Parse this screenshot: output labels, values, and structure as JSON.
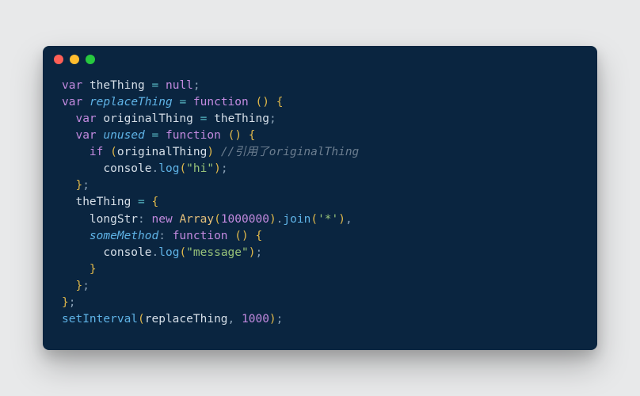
{
  "titlebar": {
    "buttons": [
      "close",
      "minimize",
      "zoom"
    ]
  },
  "code": {
    "tokens": [
      [
        {
          "t": "kw",
          "v": "var"
        },
        {
          "t": "punct",
          "v": " "
        },
        {
          "t": "ident",
          "v": "theThing"
        },
        {
          "t": "punct",
          "v": " "
        },
        {
          "t": "op",
          "v": "="
        },
        {
          "t": "punct",
          "v": " "
        },
        {
          "t": "null",
          "v": "null"
        },
        {
          "t": "punct",
          "v": ";"
        }
      ],
      [
        {
          "t": "kw",
          "v": "var"
        },
        {
          "t": "punct",
          "v": " "
        },
        {
          "t": "fn",
          "v": "replaceThing"
        },
        {
          "t": "punct",
          "v": " "
        },
        {
          "t": "op",
          "v": "="
        },
        {
          "t": "punct",
          "v": " "
        },
        {
          "t": "kw2",
          "v": "function"
        },
        {
          "t": "punct",
          "v": " "
        },
        {
          "t": "paren",
          "v": "("
        },
        {
          "t": "paren",
          "v": ")"
        },
        {
          "t": "punct",
          "v": " "
        },
        {
          "t": "paren",
          "v": "{"
        }
      ],
      [
        {
          "t": "punct",
          "v": "  "
        },
        {
          "t": "kw",
          "v": "var"
        },
        {
          "t": "punct",
          "v": " "
        },
        {
          "t": "ident",
          "v": "originalThing"
        },
        {
          "t": "punct",
          "v": " "
        },
        {
          "t": "op",
          "v": "="
        },
        {
          "t": "punct",
          "v": " "
        },
        {
          "t": "ident",
          "v": "theThing"
        },
        {
          "t": "punct",
          "v": ";"
        }
      ],
      [
        {
          "t": "punct",
          "v": "  "
        },
        {
          "t": "kw",
          "v": "var"
        },
        {
          "t": "punct",
          "v": " "
        },
        {
          "t": "fn",
          "v": "unused"
        },
        {
          "t": "punct",
          "v": " "
        },
        {
          "t": "op",
          "v": "="
        },
        {
          "t": "punct",
          "v": " "
        },
        {
          "t": "kw2",
          "v": "function"
        },
        {
          "t": "punct",
          "v": " "
        },
        {
          "t": "paren",
          "v": "("
        },
        {
          "t": "paren",
          "v": ")"
        },
        {
          "t": "punct",
          "v": " "
        },
        {
          "t": "paren",
          "v": "{"
        }
      ],
      [
        {
          "t": "punct",
          "v": "    "
        },
        {
          "t": "kw2",
          "v": "if"
        },
        {
          "t": "punct",
          "v": " "
        },
        {
          "t": "paren",
          "v": "("
        },
        {
          "t": "ident",
          "v": "originalThing"
        },
        {
          "t": "paren",
          "v": ")"
        },
        {
          "t": "punct",
          "v": " "
        },
        {
          "t": "cmt",
          "v": "//引用了originalThing"
        }
      ],
      [
        {
          "t": "punct",
          "v": "      "
        },
        {
          "t": "console",
          "v": "console"
        },
        {
          "t": "punct",
          "v": "."
        },
        {
          "t": "log",
          "v": "log"
        },
        {
          "t": "paren",
          "v": "("
        },
        {
          "t": "str",
          "v": "\"hi\""
        },
        {
          "t": "paren",
          "v": ")"
        },
        {
          "t": "punct",
          "v": ";"
        }
      ],
      [
        {
          "t": "punct",
          "v": "  "
        },
        {
          "t": "paren",
          "v": "}"
        },
        {
          "t": "punct",
          "v": ";"
        }
      ],
      [
        {
          "t": "punct",
          "v": "  "
        },
        {
          "t": "ident",
          "v": "theThing"
        },
        {
          "t": "punct",
          "v": " "
        },
        {
          "t": "op",
          "v": "="
        },
        {
          "t": "punct",
          "v": " "
        },
        {
          "t": "paren",
          "v": "{"
        }
      ],
      [
        {
          "t": "punct",
          "v": "    "
        },
        {
          "t": "propkey",
          "v": "longStr"
        },
        {
          "t": "punct",
          "v": ": "
        },
        {
          "t": "kw",
          "v": "new"
        },
        {
          "t": "punct",
          "v": " "
        },
        {
          "t": "cls",
          "v": "Array"
        },
        {
          "t": "paren",
          "v": "("
        },
        {
          "t": "num",
          "v": "1000000"
        },
        {
          "t": "paren",
          "v": ")"
        },
        {
          "t": "punct",
          "v": "."
        },
        {
          "t": "log",
          "v": "join"
        },
        {
          "t": "paren",
          "v": "("
        },
        {
          "t": "str",
          "v": "'*'"
        },
        {
          "t": "paren",
          "v": ")"
        },
        {
          "t": "punct",
          "v": ","
        }
      ],
      [
        {
          "t": "punct",
          "v": "    "
        },
        {
          "t": "fn",
          "v": "someMethod"
        },
        {
          "t": "punct",
          "v": ": "
        },
        {
          "t": "kw2",
          "v": "function"
        },
        {
          "t": "punct",
          "v": " "
        },
        {
          "t": "paren",
          "v": "("
        },
        {
          "t": "paren",
          "v": ")"
        },
        {
          "t": "punct",
          "v": " "
        },
        {
          "t": "paren",
          "v": "{"
        }
      ],
      [
        {
          "t": "punct",
          "v": "      "
        },
        {
          "t": "console",
          "v": "console"
        },
        {
          "t": "punct",
          "v": "."
        },
        {
          "t": "log",
          "v": "log"
        },
        {
          "t": "paren",
          "v": "("
        },
        {
          "t": "str",
          "v": "\"message\""
        },
        {
          "t": "paren",
          "v": ")"
        },
        {
          "t": "punct",
          "v": ";"
        }
      ],
      [
        {
          "t": "punct",
          "v": "    "
        },
        {
          "t": "paren",
          "v": "}"
        }
      ],
      [
        {
          "t": "punct",
          "v": "  "
        },
        {
          "t": "paren",
          "v": "}"
        },
        {
          "t": "punct",
          "v": ";"
        }
      ],
      [
        {
          "t": "paren",
          "v": "}"
        },
        {
          "t": "punct",
          "v": ";"
        }
      ],
      [
        {
          "t": "log",
          "v": "setInterval"
        },
        {
          "t": "paren",
          "v": "("
        },
        {
          "t": "ident",
          "v": "replaceThing"
        },
        {
          "t": "punct",
          "v": ", "
        },
        {
          "t": "num",
          "v": "1000"
        },
        {
          "t": "paren",
          "v": ")"
        },
        {
          "t": "punct",
          "v": ";"
        }
      ]
    ]
  }
}
